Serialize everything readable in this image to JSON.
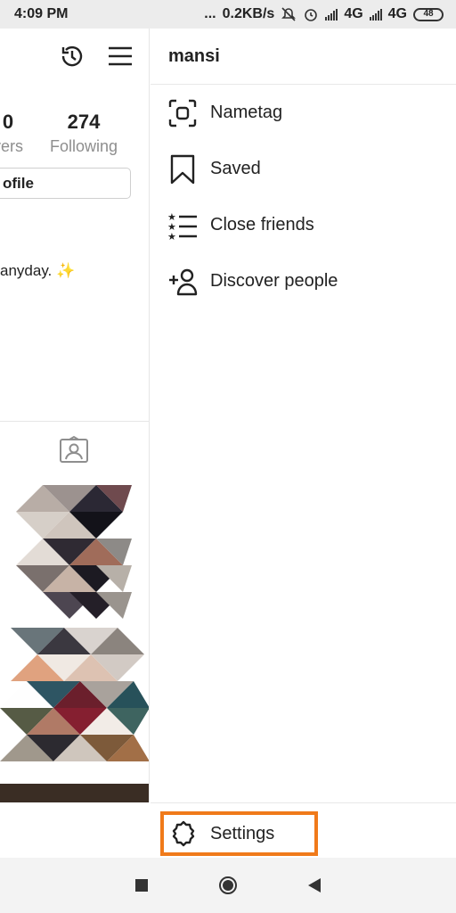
{
  "status_bar": {
    "time": "4:09 PM",
    "net_dots": "...",
    "net_speed": "0.2KB/s",
    "network_1": "4G",
    "network_2": "4G",
    "battery": "48"
  },
  "profile": {
    "followers_count": "0",
    "followers_label": "vers",
    "following_count": "274",
    "following_label": "Following",
    "edit_profile_label": "ofile",
    "bio": "anyday.",
    "bio_emoji": "✨"
  },
  "drawer": {
    "username": "mansi",
    "items": [
      {
        "label": "Nametag",
        "icon": "nametag-icon"
      },
      {
        "label": "Saved",
        "icon": "bookmark-icon"
      },
      {
        "label": "Close friends",
        "icon": "close-friends-icon"
      },
      {
        "label": "Discover people",
        "icon": "add-person-icon"
      }
    ],
    "settings_label": "Settings",
    "highlight_color": "#f07a1a"
  },
  "nav_bar": {
    "icons": [
      "recents-icon",
      "home-icon",
      "back-icon"
    ]
  }
}
